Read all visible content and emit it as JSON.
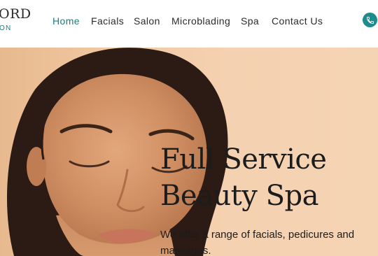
{
  "header": {
    "logo_main": "ORD",
    "logo_sub": "ON",
    "nav": [
      {
        "label": "Home",
        "active": true
      },
      {
        "label": "Facials",
        "active": false
      },
      {
        "label": "Salon",
        "active": false
      },
      {
        "label": "Microblading",
        "active": false
      },
      {
        "label": "Spa",
        "active": false
      },
      {
        "label": "Contact Us",
        "active": false
      }
    ],
    "phone_icon": "phone-icon"
  },
  "hero": {
    "title_line1": "Full Service",
    "title_line2": "Beauty Spa",
    "subtitle": "We offer a range of facials, pedicures and massages."
  },
  "colors": {
    "accent": "#1b7e80",
    "text": "#1c1c1c",
    "hero_bg": "#f4d1b0"
  }
}
